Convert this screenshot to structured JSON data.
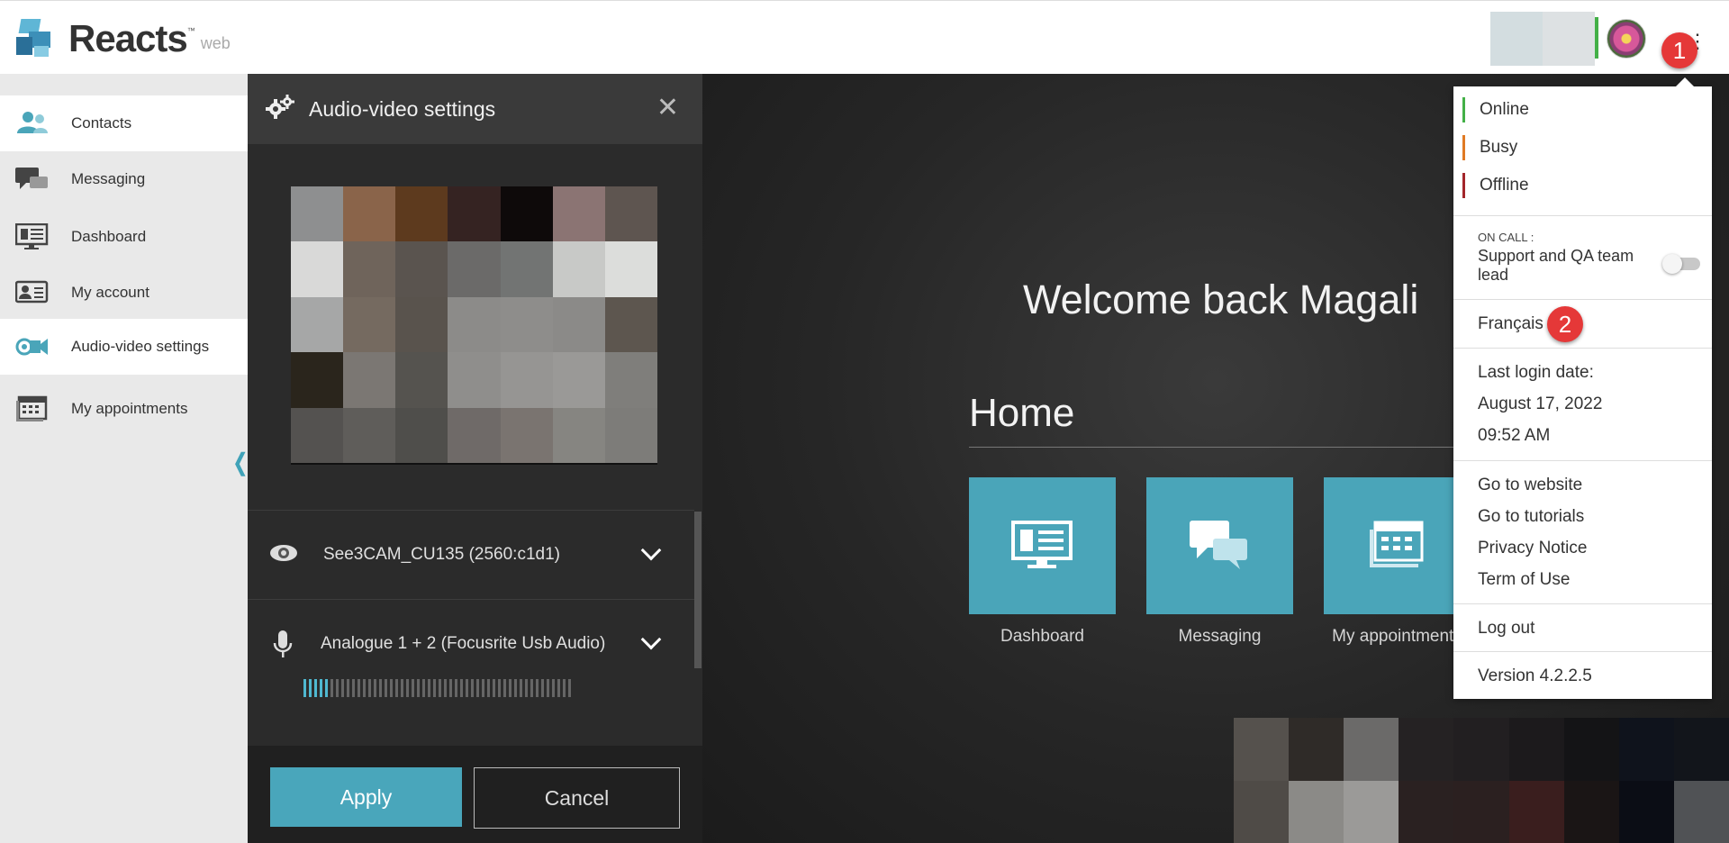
{
  "header": {
    "logo_text": "Reacts",
    "logo_tm": "™",
    "logo_sub": "web",
    "more_icon": "⋮",
    "badge1": "1",
    "badge2": "2"
  },
  "sidebar": {
    "items": [
      {
        "label": "Contacts",
        "icon": "contacts-icon"
      },
      {
        "label": "Messaging",
        "icon": "messaging-icon"
      },
      {
        "label": "Dashboard",
        "icon": "dashboard-icon"
      },
      {
        "label": "My account",
        "icon": "account-card-icon"
      },
      {
        "label": "Audio-video settings",
        "icon": "camera-icon"
      },
      {
        "label": "My appointments",
        "icon": "calendar-icon"
      }
    ],
    "collapse": "❬"
  },
  "av_settings": {
    "title": "Audio-video settings",
    "close": "✕",
    "camera": "See3CAM_CU135 (2560:c1d1)",
    "microphone": "Analogue 1 + 2 (Focusrite Usb Audio)",
    "apply": "Apply",
    "cancel": "Cancel",
    "mic_level": 0.1
  },
  "main": {
    "welcome": "Welcome back Magali",
    "home_title": "Home",
    "tiles": [
      {
        "label": "Dashboard",
        "icon": "dashboard-icon"
      },
      {
        "label": "Messaging",
        "icon": "messaging-icon"
      },
      {
        "label": "My appointments",
        "icon": "calendar-icon"
      }
    ]
  },
  "dropdown": {
    "statuses": [
      {
        "label": "Online",
        "color": "#43b047"
      },
      {
        "label": "Busy",
        "color": "#e07a24"
      },
      {
        "label": "Offline",
        "color": "#a3262b"
      }
    ],
    "on_call_label": "ON CALL :",
    "on_call_value": "Support and QA team lead",
    "language": "Français",
    "last_login_label": "Last login date:",
    "last_login_date": "August 17, 2022",
    "last_login_time": "09:52 AM",
    "links": [
      "Go to website",
      "Go to tutorials",
      "Privacy Notice",
      "Term of Use"
    ],
    "logout": "Log out",
    "version": "Version 4.2.2.5"
  },
  "colors": {
    "accent": "#4aa5b9",
    "badge": "#e53838"
  }
}
